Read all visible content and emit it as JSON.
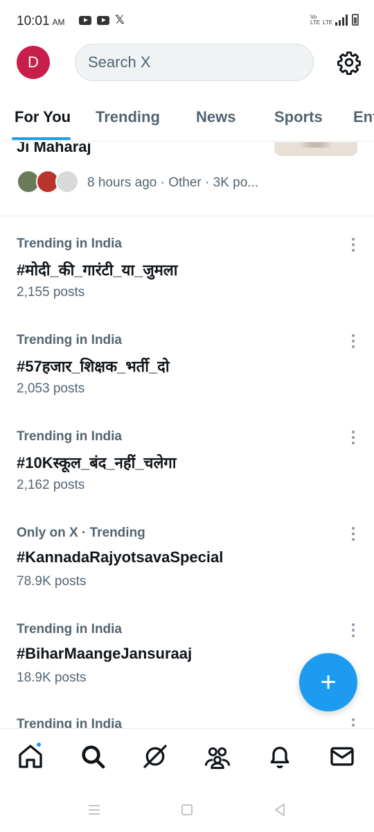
{
  "status_bar": {
    "time": "10:01",
    "ampm": "AM",
    "network_label": "Vo LTE",
    "network_label2": "LTE"
  },
  "header": {
    "avatar_letter": "D",
    "search_placeholder": "Search X"
  },
  "tabs": [
    {
      "label": "For You",
      "active": true
    },
    {
      "label": "Trending",
      "active": false
    },
    {
      "label": "News",
      "active": false
    },
    {
      "label": "Sports",
      "active": false
    },
    {
      "label": "Ent",
      "active": false
    }
  ],
  "story": {
    "title_tail": "Ji Maharaj",
    "meta": "8 hours ago · Other · 3K po..."
  },
  "trends": [
    {
      "context": "Trending in India",
      "tag": "#मोदी_की_गारंटी_या_जुमला",
      "count": "2,155 posts"
    },
    {
      "context": "Trending in India",
      "tag": "#57हजार_शिक्षक_भर्ती_दो",
      "count": "2,053 posts"
    },
    {
      "context": "Trending in India",
      "tag": "#10Kस्कूल_बंद_नहीं_चलेगा",
      "count": "2,162 posts"
    },
    {
      "context": "Only on X · Trending",
      "tag": "#KannadaRajyotsavaSpecial",
      "count": "78.9K posts"
    },
    {
      "context": "Trending in India",
      "tag": "#BiharMaangeJansuraaj",
      "count": "18.9K posts"
    },
    {
      "context": "Trending in India",
      "tag": "",
      "count": ""
    }
  ],
  "fab": {
    "symbol": "+"
  },
  "icons": {
    "home": "home-icon",
    "search": "search-icon",
    "grok": "grok-icon",
    "communities": "communities-icon",
    "notifications": "bell-icon",
    "messages": "mail-icon"
  },
  "colors": {
    "accent": "#1d9bf0",
    "avatar": "#c81e4b",
    "text_secondary": "#536471"
  }
}
